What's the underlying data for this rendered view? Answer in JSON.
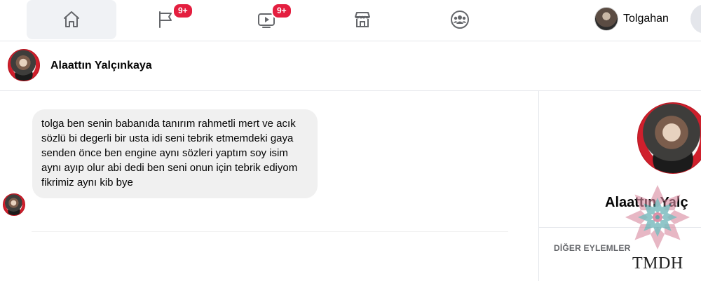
{
  "nav": {
    "tabs": [
      {
        "name": "home",
        "icon": "home-icon",
        "active": true
      },
      {
        "name": "pages",
        "icon": "flag-icon",
        "badge": "9+"
      },
      {
        "name": "watch",
        "icon": "video-icon",
        "badge": "9+"
      },
      {
        "name": "marketplace",
        "icon": "store-icon"
      },
      {
        "name": "groups",
        "icon": "groups-icon"
      }
    ],
    "profile_name": "Tolgahan"
  },
  "chat": {
    "contact_name": "Alaattın Yalçınkaya",
    "message": "tolga ben senin babanıda tanırım rahmetli mert ve acık sözlü bi degerli bir usta idi seni tebrik etmemdeki gaya senden önce ben engine aynı sözleri yaptım soy isim aynı ayıp olur abi dedi ben seni onun için tebrik ediyom fikrimiz aynı kib bye"
  },
  "panel": {
    "name": "Alaattın Yalç",
    "section_label": "DİĞER EYLEMLER"
  },
  "watermark": {
    "text": "TMDH"
  },
  "colors": {
    "badge": "#e41e3f",
    "bubble": "#f0f0f0",
    "icon": "#65676b",
    "divider": "#e4e6eb"
  }
}
